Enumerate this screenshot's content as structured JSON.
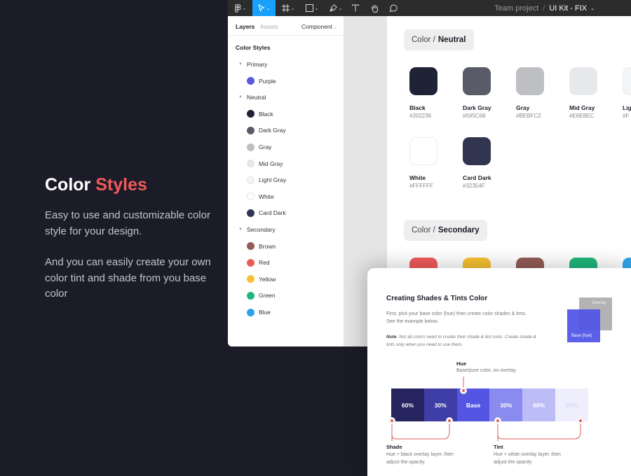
{
  "hero": {
    "title_main": "Color",
    "title_accent": "Styles",
    "para1": "Easy to use and customizable color style for your design.",
    "para2": "And you can easily create your own color tint and shade from you base color"
  },
  "toolbar": {
    "tools": [
      "figma-menu-icon",
      "move-icon",
      "frame-icon",
      "shape-icon",
      "pen-icon",
      "text-icon",
      "hand-icon",
      "comment-icon"
    ],
    "project": "Team project",
    "separator": "/",
    "file_name": "UI Kit - FIX"
  },
  "sidebar": {
    "tab_layers": "Layers",
    "tab_assets": "Assets",
    "tab_component": "Component",
    "section_title": "Color Styles",
    "groups": [
      {
        "name": "Primary",
        "items": [
          {
            "label": "Purple",
            "color": "#5a57e0"
          }
        ]
      },
      {
        "name": "Neutral",
        "items": [
          {
            "label": "Black",
            "color": "#202236"
          },
          {
            "label": "Dark Gray",
            "color": "#595C68"
          },
          {
            "label": "Gray",
            "color": "#BEBFC2"
          },
          {
            "label": "Mid Gray",
            "color": "#E6E8EC"
          },
          {
            "label": "Light Gray",
            "color": "#F4F5F7"
          },
          {
            "label": "White",
            "color": "#FFFFFF"
          },
          {
            "label": "Card Dark",
            "color": "#32354F"
          }
        ]
      },
      {
        "name": "Secondary",
        "items": [
          {
            "label": "Brown",
            "color": "#935c55"
          },
          {
            "label": "Red",
            "color": "#ef5a5a"
          },
          {
            "label": "Yellow",
            "color": "#f8c131"
          },
          {
            "label": "Green",
            "color": "#21b67a"
          },
          {
            "label": "Blue",
            "color": "#2fa3e8"
          }
        ]
      }
    ]
  },
  "canvas": {
    "neutral_label": {
      "prefix": "Color /",
      "name": "Neutral"
    },
    "secondary_label": {
      "prefix": "Color /",
      "name": "Secondary"
    },
    "neutral_swatches": [
      {
        "name": "Black",
        "hex": "#202236",
        "color": "#202236"
      },
      {
        "name": "Dark Gray",
        "hex": "#595C68",
        "color": "#595C68"
      },
      {
        "name": "Gray",
        "hex": "#BEBFC2",
        "color": "#BEBFC2"
      },
      {
        "name": "Mid Gray",
        "hex": "#E6E8EC",
        "color": "#E6E8EC"
      },
      {
        "name": "Lig",
        "hex": "#F",
        "color": "#F4F5F7"
      },
      {
        "name": "White",
        "hex": "#FFFFFF",
        "color": "#FFFFFF"
      },
      {
        "name": "Card Dark",
        "hex": "#32354F",
        "color": "#32354F"
      }
    ],
    "secondary_swatch_colors": [
      "#ef5a5a",
      "#f8c131",
      "#935c55",
      "#21b67a",
      "#2fa3e8"
    ]
  },
  "shades_card": {
    "title": "Creating Shades & Tints Color",
    "desc": "First, pick your base color (hue) then create color shades & tints. See the example below.",
    "note_label": "Note",
    "note_text": ": Not all colors need to create their shade & tint color. Create shade & tints only when you need to use them.",
    "overlay_label": "Overlay",
    "base_label": "Base (hue)",
    "hue_title": "Hue",
    "hue_sub": "Base/pure color, no overlay",
    "strip": [
      {
        "label": "60%",
        "color": "#25245f"
      },
      {
        "label": "30%",
        "color": "#3f3ea6"
      },
      {
        "label": "Base",
        "color": "#5456e3"
      },
      {
        "label": "30%",
        "color": "#8a8bef"
      },
      {
        "label": "60%",
        "color": "#bcbdf6"
      },
      {
        "label": "90%",
        "color": "#eeeefd"
      }
    ],
    "shade_title": "Shade",
    "shade_sub": "Hue + black overlay layer, then adjust the opacity.",
    "tint_title": "Tint",
    "tint_sub": "Hue + white overlay layer, then adjust the opacity"
  }
}
